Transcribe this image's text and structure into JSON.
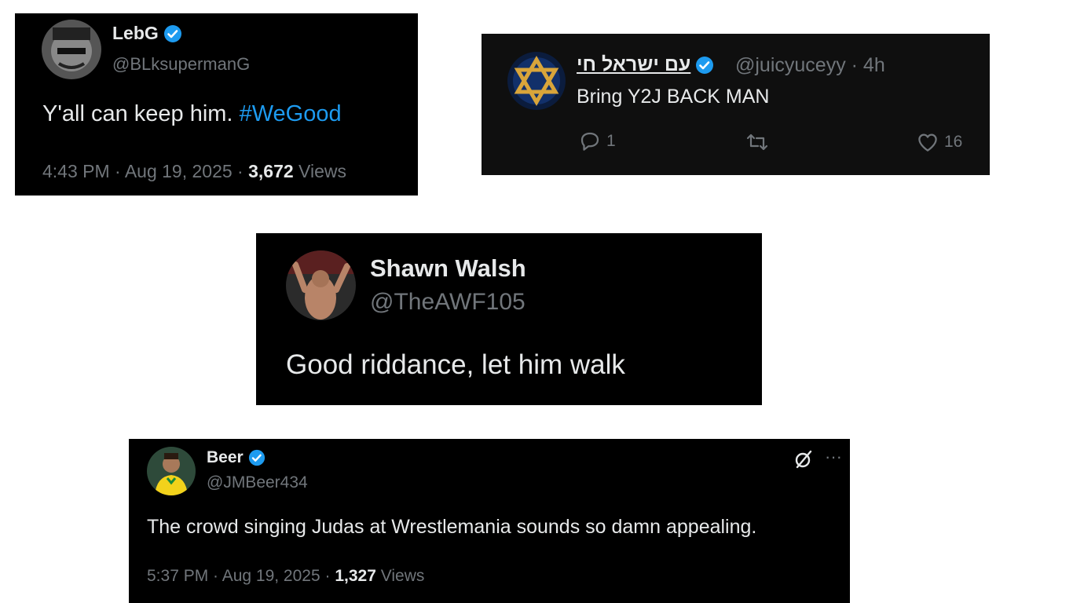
{
  "tweet1": {
    "name": "LebG",
    "handle": "@BLksupermanG",
    "text_plain": "Y'all can keep him. ",
    "hashtag": "#WeGood",
    "time": "4:43 PM · Aug 19, 2025 · ",
    "views_count": "3,672",
    "views_label": " Views"
  },
  "tweet2": {
    "name": "עם ישראל חי",
    "handle": "@juicyuceyy · 4h",
    "text": "Bring Y2J BACK MAN",
    "reply_count": "1",
    "like_count": "16"
  },
  "tweet3": {
    "name": "Shawn Walsh",
    "handle": "@TheAWF105",
    "text": "Good riddance, let him walk"
  },
  "tweet4": {
    "name": "Beer",
    "handle": "@JMBeer434",
    "text": "The crowd singing Judas at Wrestlemania sounds so damn appealing.",
    "time": "5:37 PM · Aug 19, 2025 · ",
    "views_count": "1,327",
    "views_label": " Views",
    "more": "···"
  },
  "colors": {
    "background": "#ffffff",
    "card": "#000000",
    "text": "#e7e9ea",
    "secondary": "#71767b",
    "accent": "#1d9bf0"
  },
  "icons": [
    "verified-badge-icon",
    "reply-icon",
    "retweet-icon",
    "like-icon",
    "grok-icon",
    "more-icon"
  ]
}
